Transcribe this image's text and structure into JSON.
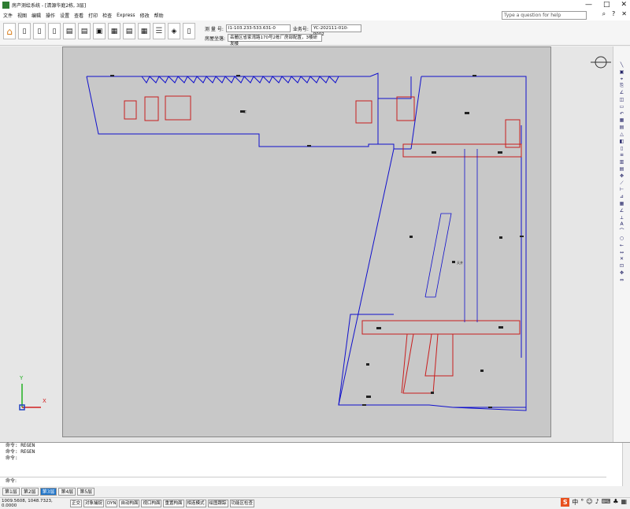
{
  "window": {
    "title": "房产测绘系统 - [清源华庭2栋, 3层]",
    "controls": [
      "—",
      "□",
      "✕"
    ]
  },
  "menu": [
    "文件",
    "视图",
    "编辑",
    "操作",
    "设置",
    "查看",
    "打印",
    "检查",
    "Express",
    "修改",
    "帮助"
  ],
  "help": {
    "search_placeholder": "Type a question for help"
  },
  "info": {
    "survey_label": "测 量 号:",
    "survey_value": "I1-103.233-533.631-0",
    "business_label": "业务号:",
    "business_value": "YC-202111-010-P002",
    "address_label": "房屋坐落:",
    "address_value": "岳麓区省家湾路170号2栋厂房部配置，3楼研发楼"
  },
  "plan": {
    "main_label": "3F层",
    "area_label": "天井"
  },
  "command": {
    "history": [
      "命令: REGEN",
      "命令: REGEN",
      "命令:"
    ],
    "prompt": "命令:"
  },
  "tabs": [
    "第1层",
    "第2层",
    "第3层",
    "第4层",
    "第5层"
  ],
  "active_tab": 2,
  "status": {
    "coords": "1009.5608, 1048.7323, 0.0000",
    "modes": [
      "正交",
      "对象捕捉",
      "DYN",
      "自动构面",
      "视口构面",
      "重置构面",
      "相连模式",
      "绘图跟踪",
      "功能区检查"
    ]
  },
  "colors": {
    "blue_line": "#1010cc",
    "red_line": "#c81e1e",
    "paper": "#c8c8c8"
  }
}
